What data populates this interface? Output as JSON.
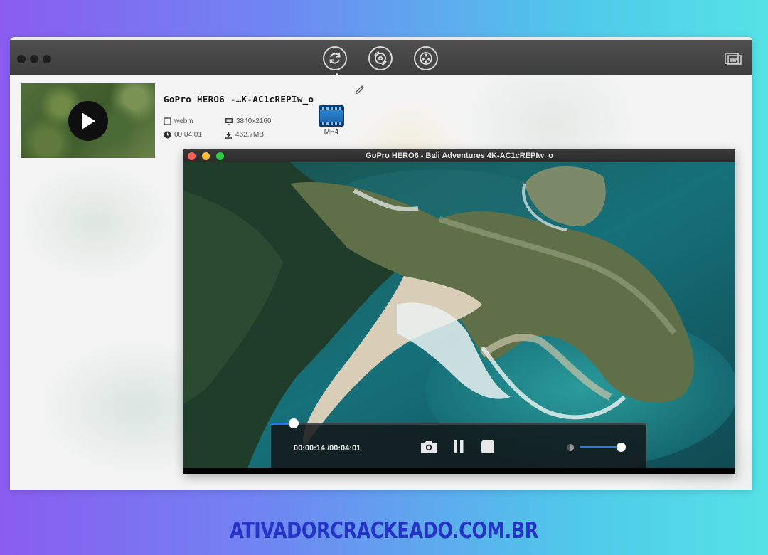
{
  "colors": {
    "accent": "#2d7be0",
    "watermark": "#2533c9",
    "light_close": "#fc5f56",
    "light_min": "#fdbc2e",
    "light_max": "#29c840"
  },
  "toolbar": {
    "tools": [
      {
        "icon": "convert-icon",
        "active": true
      },
      {
        "icon": "burn-icon",
        "active": false
      },
      {
        "icon": "media-icon",
        "active": false
      }
    ],
    "right_icon": "subtitle-icon"
  },
  "file": {
    "name": "GoPro HERO6 -…K-AC1cREPIw_o",
    "format": "webm",
    "resolution": "3840x2160",
    "duration": "00:04:01",
    "size": "462.7MB",
    "output_format": "MP4"
  },
  "player": {
    "title": "GoPro HERO6 - Bali Adventures 4K-AC1cREPIw_o",
    "timecode": "00:00:14 /00:04:01",
    "progress": 0.06,
    "volume": 1.0
  },
  "watermark": {
    "text": "ATIVADORCRACKEADO.COM.BR"
  }
}
